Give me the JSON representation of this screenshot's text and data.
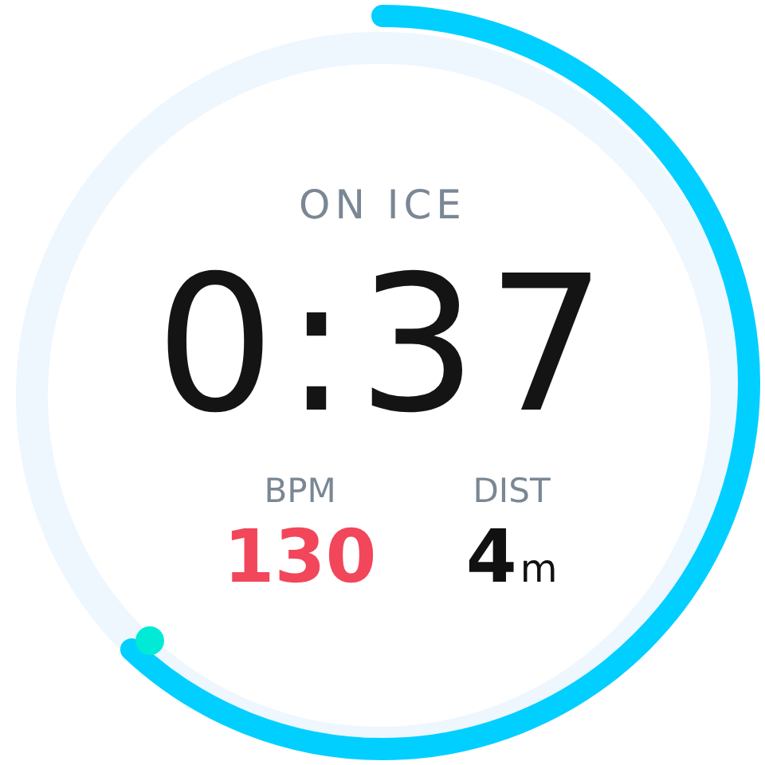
{
  "status": "ON ICE",
  "timer": "0:37",
  "progress": {
    "level": 0.62
  },
  "stats": [
    {
      "label": "BPM",
      "value": "130",
      "color": "#f2465a"
    },
    {
      "label": "DIST",
      "value": "4",
      "unit": "m",
      "color": "#111111"
    }
  ]
}
